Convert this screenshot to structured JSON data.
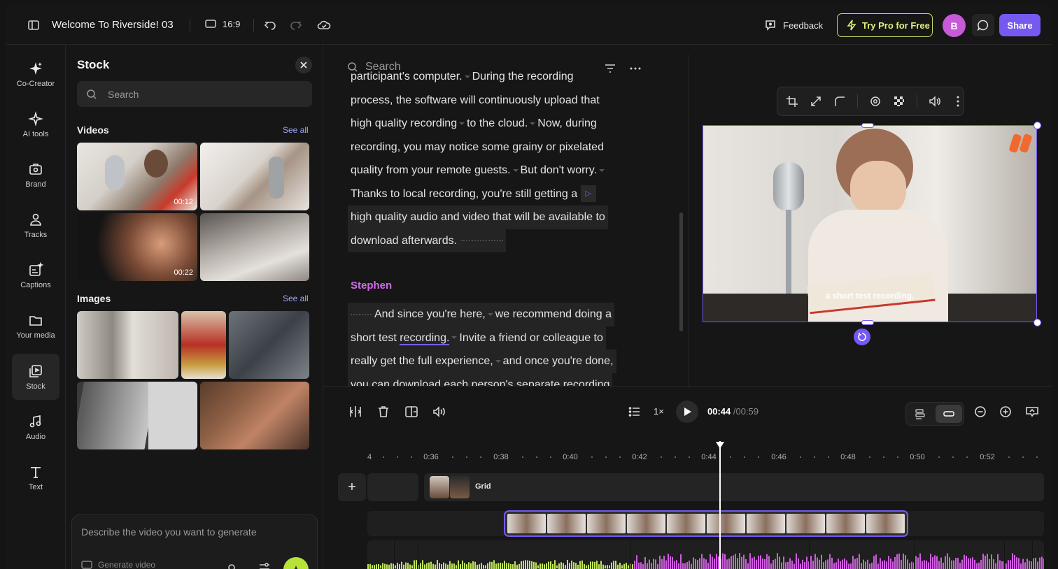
{
  "project": {
    "title": "Welcome To Riverside! 03",
    "aspect_ratio": "16:9"
  },
  "topbar": {
    "feedback_label": "Feedback",
    "trypro_label": "Try Pro for Free",
    "avatar_initial": "B",
    "share_label": "Share",
    "accent_color": "#7659f0",
    "pro_color": "#e4f07a"
  },
  "rail": {
    "items": [
      {
        "label": "Co-Creator",
        "icon": "sparkle-icon"
      },
      {
        "label": "AI tools",
        "icon": "ai-tools-icon"
      },
      {
        "label": "Brand",
        "icon": "brand-icon"
      },
      {
        "label": "Tracks",
        "icon": "tracks-icon"
      },
      {
        "label": "Captions",
        "icon": "captions-icon"
      },
      {
        "label": "Your media",
        "icon": "folder-icon"
      },
      {
        "label": "Stock",
        "icon": "stock-icon"
      },
      {
        "label": "Audio",
        "icon": "music-note-icon"
      },
      {
        "label": "Text",
        "icon": "text-icon"
      }
    ],
    "active": "Stock"
  },
  "stock": {
    "title": "Stock",
    "search_placeholder": "Search",
    "videos_title": "Videos",
    "images_title": "Images",
    "see_all_label": "See all",
    "video_durations": [
      "00:12",
      "00:22"
    ],
    "generate_placeholder": "Describe the video you want to generate",
    "generate_label": "Generate video"
  },
  "transcript": {
    "search_placeholder": "Search",
    "lines": [
      "participant's computer.",
      "During the recording",
      "process, the software will continuously upload that",
      "high quality recording",
      "to the cloud.",
      "Now, during",
      "recording, you may notice some grainy or pixelated",
      "quality from your remote guests.",
      "But don't worry.",
      "Thanks to local recording, you're still getting a",
      "high quality audio and video that will be available to",
      "download afterwards."
    ],
    "speaker": "Stephen",
    "lines2": [
      "And since you're here,",
      "we recommend doing a",
      "short test",
      "recording.",
      "Invite a friend or colleague to",
      "really get the full experience,",
      "and once you're done,",
      "you can download each person's separate recording"
    ]
  },
  "preview": {
    "caption": "a short test recording."
  },
  "timeline": {
    "speed": "1×",
    "current_time": "00:44",
    "total_time": "/00:59",
    "ruler_labels": [
      "4",
      "0:36",
      "0:38",
      "0:40",
      "0:42",
      "0:44",
      "0:46",
      "0:48",
      "0:50",
      "0:52"
    ],
    "grid_track_label": "Grid",
    "add_label": "+"
  }
}
